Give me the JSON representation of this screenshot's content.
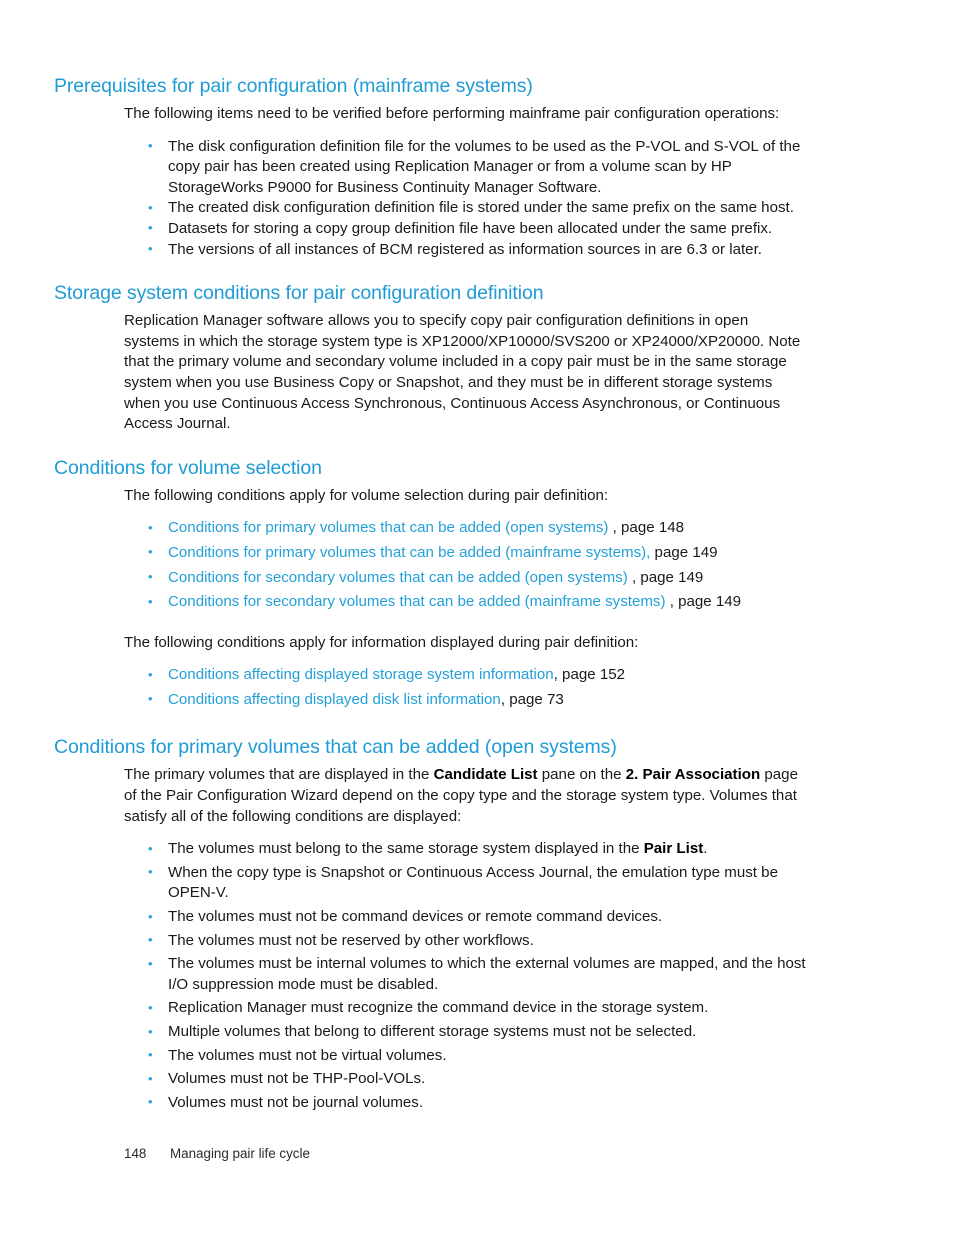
{
  "document": {
    "footer": {
      "page_number": "148",
      "chapter_title": "Managing pair life cycle"
    },
    "accent_color": "#1f9cd6",
    "link_color": "#23a0d8",
    "bullet_color": "#2aa3dc"
  },
  "sections": [
    {
      "heading": "Prerequisites for pair configuration (mainframe systems)",
      "intro": "The following items need to be verified before performing mainframe pair configuration operations:",
      "bullets": [
        "The disk configuration definition file for the volumes to be used as the P-VOL and S-VOL of the copy pair has been created using Replication Manager or from a volume scan by HP StorageWorks P9000 for Business Continuity Manager Software.",
        "The created disk configuration definition file is stored under the same prefix on the same host.",
        "Datasets for storing a copy group definition file have been allocated under the same prefix.",
        "The versions of all instances of BCM registered as information sources in are 6.3 or later."
      ]
    },
    {
      "heading": "Storage system conditions for pair configuration definition",
      "paragraph": "Replication Manager software allows you to specify copy pair configuration definitions in open systems in which the storage system type is XP12000/XP10000/SVS200 or XP24000/XP20000. Note that the primary volume and secondary volume included in a copy pair must be in the same storage system when you use Business Copy or Snapshot, and they must be in different storage systems when you use Continuous Access Synchronous, Continuous Access Asynchronous, or Continuous Access Journal."
    },
    {
      "heading": "Conditions for volume selection",
      "intro": "The following conditions apply for volume selection during pair definition:",
      "link_bullets": [
        {
          "link_text": "Conditions for primary volumes that can be added (open systems)",
          "separator": " , page ",
          "page": "148"
        },
        {
          "link_text": "Conditions for primary volumes that can be added (mainframe systems),",
          "separator": " page ",
          "page": "149"
        },
        {
          "link_text": "Conditions for secondary volumes that can be added (open systems)",
          "separator": " , page ",
          "page": "149"
        },
        {
          "link_text": "Conditions for secondary volumes that can be added (mainframe systems)",
          "separator": "  , page ",
          "page": "149"
        }
      ],
      "intro2": "The following conditions apply for information displayed during pair definition:",
      "link_bullets2": [
        {
          "link_text": "Conditions affecting displayed storage system information",
          "separator": ", page ",
          "page": "152"
        },
        {
          "link_text": "Conditions affecting displayed disk list information",
          "separator": ", page ",
          "page": "73"
        }
      ]
    },
    {
      "heading": "Conditions for primary volumes that can be added (open systems)",
      "paragraph_parts": {
        "p1": "The primary volumes that are displayed in the ",
        "b1": "Candidate List",
        "p2": " pane on the ",
        "b2": "2. Pair Association",
        "p3": " page of the Pair Configuration Wizard depend on the copy type and the storage system type. Volumes that satisfy all of the following conditions are displayed:"
      },
      "bullets_rich": [
        {
          "p1": "The volumes must belong to the same storage system displayed in the ",
          "b1": "Pair List",
          "p2": "."
        },
        {
          "p1": "When the copy type is Snapshot or Continuous Access Journal, the emulation type must be OPEN-V.",
          "b1": "",
          "p2": ""
        },
        {
          "p1": "The volumes must not be command devices or remote command devices.",
          "b1": "",
          "p2": ""
        },
        {
          "p1": "The volumes must not be reserved by other workflows.",
          "b1": "",
          "p2": ""
        },
        {
          "p1": "The volumes must be internal volumes to which the external volumes are mapped, and the host I/O suppression mode must be disabled.",
          "b1": "",
          "p2": ""
        },
        {
          "p1": "Replication Manager must recognize the command device in the storage system.",
          "b1": "",
          "p2": ""
        },
        {
          "p1": "Multiple volumes that belong to different storage systems must not be selected.",
          "b1": "",
          "p2": ""
        },
        {
          "p1": "The volumes must not be virtual volumes.",
          "b1": "",
          "p2": ""
        },
        {
          "p1": "Volumes must not be THP-Pool-VOLs.",
          "b1": "",
          "p2": ""
        },
        {
          "p1": "Volumes must not be journal volumes.",
          "b1": "",
          "p2": ""
        }
      ]
    }
  ]
}
